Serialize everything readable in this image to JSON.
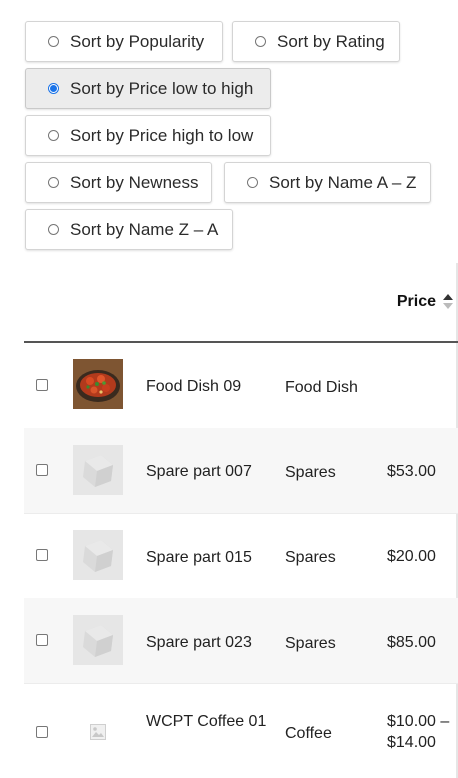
{
  "sort_options": [
    {
      "label": "Sort by Popularity",
      "selected": false
    },
    {
      "label": "Sort by Rating",
      "selected": false
    },
    {
      "label": "Sort by Price low to high",
      "selected": true
    },
    {
      "label": "Sort by Price high to low",
      "selected": false
    },
    {
      "label": "Sort by Newness",
      "selected": false
    },
    {
      "label": "Sort by Name A – Z",
      "selected": false
    },
    {
      "label": "Sort by Name Z – A",
      "selected": false
    }
  ],
  "table": {
    "headers": {
      "price": "Price"
    },
    "rows": [
      {
        "name": "Food Dish 09",
        "category": "Food Dish",
        "price": "",
        "thumbnail": "food-photo"
      },
      {
        "name": "Spare part 007",
        "category": "Spares",
        "price": "$53.00",
        "thumbnail": "placeholder-cube"
      },
      {
        "name": "Spare part 015",
        "category": "Spares",
        "price": "$20.00",
        "thumbnail": "placeholder-cube"
      },
      {
        "name": "Spare part 023",
        "category": "Spares",
        "price": "$85.00",
        "thumbnail": "placeholder-cube"
      },
      {
        "name": "WCPT Coffee 01",
        "category": "Coffee",
        "price": "$10.00 – $14.00",
        "thumbnail": "image-placeholder-icon"
      }
    ]
  },
  "colors": {
    "accent": "#1a73e8",
    "header_border": "#555555",
    "alt_row": "#f7f7f7"
  }
}
